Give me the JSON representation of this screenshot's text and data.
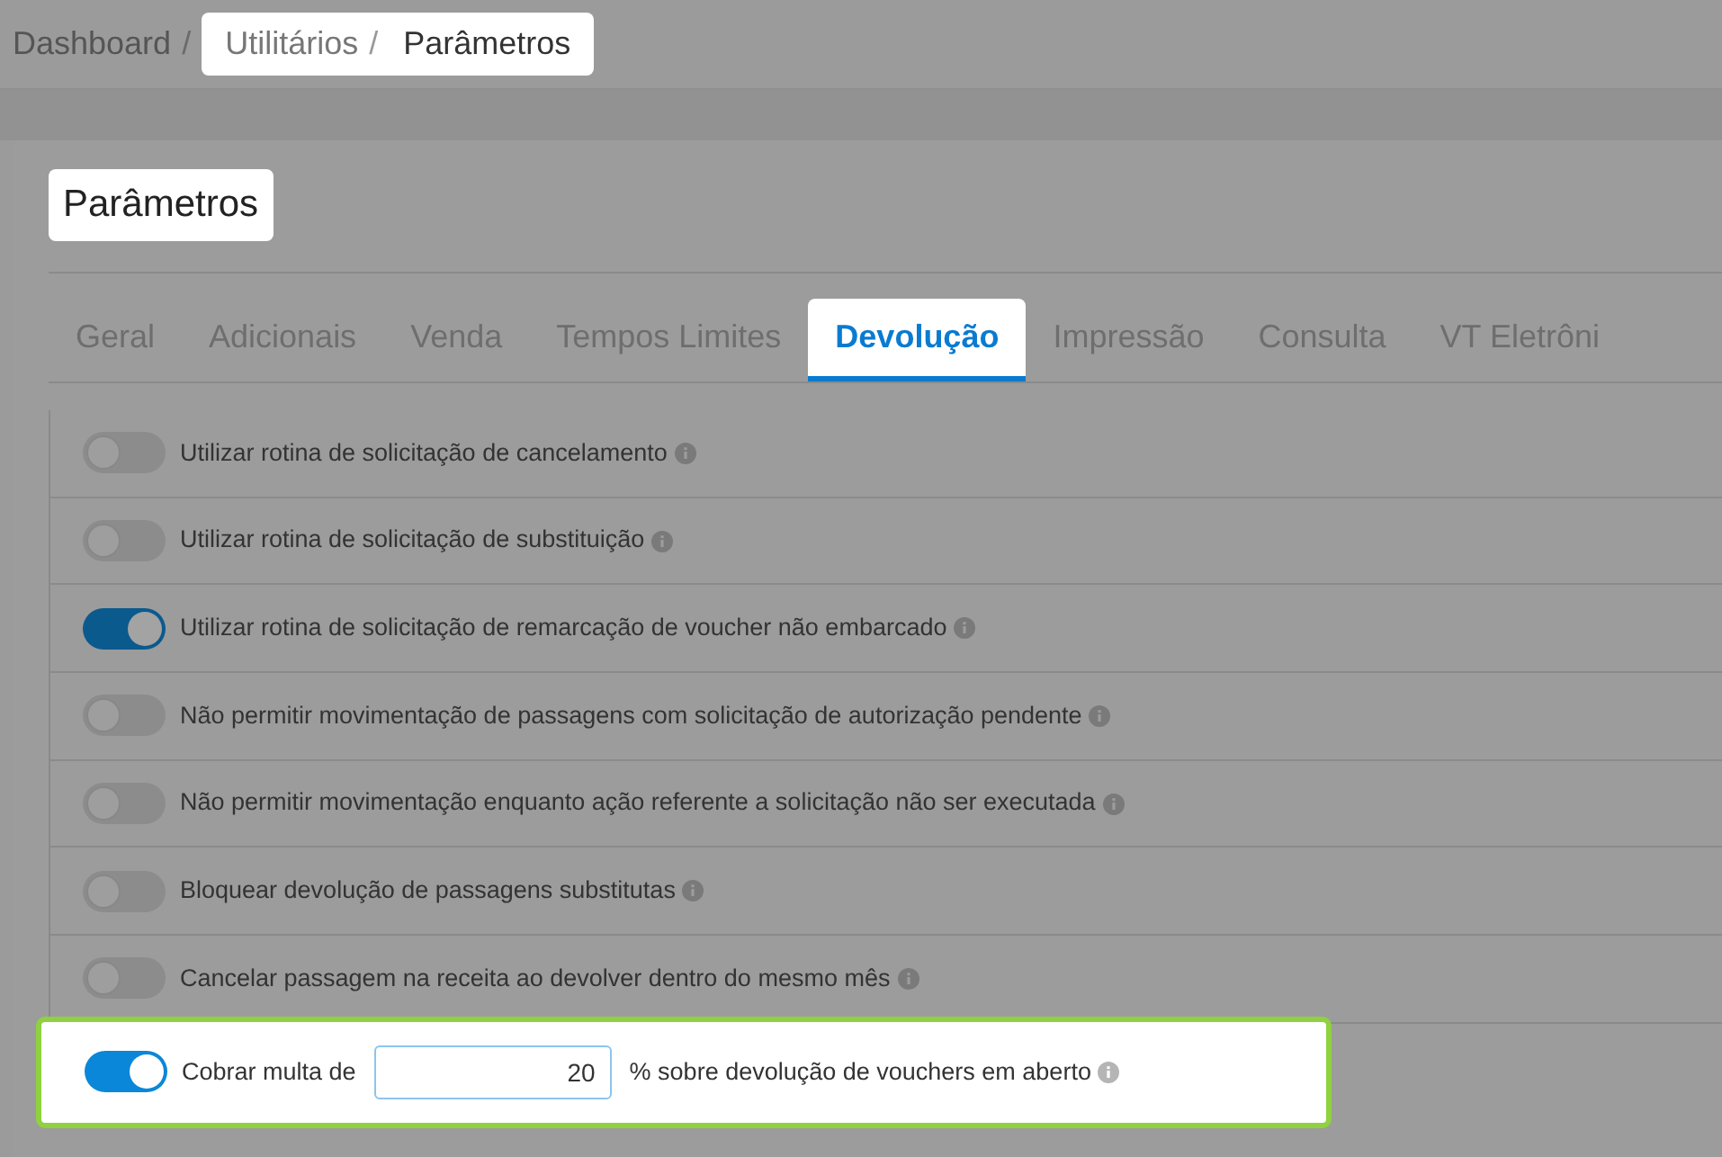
{
  "breadcrumb": [
    {
      "kind": "link",
      "label": "Dashboard",
      "highlighted": false
    },
    {
      "kind": "separator",
      "label": "/",
      "highlighted": false
    },
    {
      "kind": "link",
      "label": "Utilitários",
      "highlighted": true
    },
    {
      "kind": "separator",
      "label": "/",
      "highlighted": true
    },
    {
      "kind": "current",
      "label": "Parâmetros",
      "highlighted": true
    }
  ],
  "page_title": {
    "text": "Parâmetros",
    "highlighted": true
  },
  "tabs": [
    {
      "label": "Geral",
      "selected": false,
      "highlighted": false
    },
    {
      "label": "Adicionais",
      "selected": false,
      "highlighted": false
    },
    {
      "label": "Venda",
      "selected": false,
      "highlighted": false
    },
    {
      "label": "Tempos Limites",
      "selected": false,
      "highlighted": false
    },
    {
      "label": "Devolução",
      "selected": true,
      "highlighted": true
    },
    {
      "label": "Impressão",
      "selected": false,
      "highlighted": false
    },
    {
      "label": "Consulta",
      "selected": false,
      "highlighted": false
    },
    {
      "label": "VT Eletrôni",
      "selected": false,
      "highlighted": false
    }
  ],
  "settings": [
    {
      "kind": "toggle",
      "label": "Utilizar rotina de solicitação de cancelamento",
      "on": false,
      "highlighted": false
    },
    {
      "kind": "toggle",
      "label": "Utilizar rotina de solicitação de substituição",
      "on": false,
      "highlighted": false
    },
    {
      "kind": "toggle",
      "label": "Utilizar rotina de solicitação de remarcação de voucher não embarcado",
      "on": true,
      "highlighted": false
    },
    {
      "kind": "toggle",
      "label": "Não permitir movimentação de passagens com solicitação de autorização pendente",
      "on": false,
      "highlighted": false
    },
    {
      "kind": "toggle",
      "label": "Não permitir movimentação enquanto ação referente a solicitação não ser executada",
      "on": false,
      "highlighted": false
    },
    {
      "kind": "toggle",
      "label": "Bloquear devolução de passagens substitutas",
      "on": false,
      "highlighted": false
    },
    {
      "kind": "toggle",
      "label": "Cancelar passagem na receita ao devolver dentro do mesmo mês",
      "on": false,
      "highlighted": false
    },
    {
      "kind": "toggle_input",
      "label": "Cobrar multa de",
      "value": "20",
      "suffix": "% sobre devolução de vouchers em aberto",
      "on": true,
      "highlighted": true
    }
  ]
}
